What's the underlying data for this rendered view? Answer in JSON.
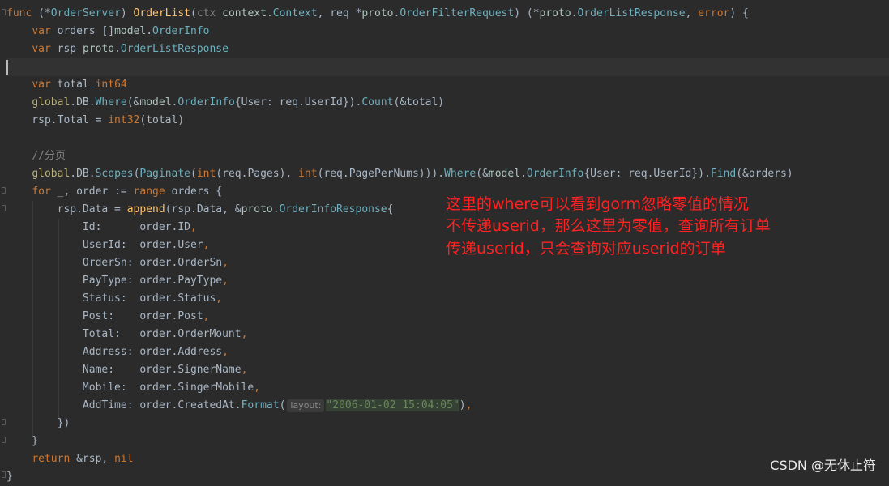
{
  "editor": {
    "lines": [
      [
        {
          "t": "func",
          "c": "kw"
        },
        {
          "t": " (*"
        },
        {
          "t": "OrderServer",
          "c": "ty"
        },
        {
          "t": ") "
        },
        {
          "t": "OrderList",
          "c": "fn"
        },
        {
          "t": "("
        },
        {
          "t": "ctx",
          "c": "cm"
        },
        {
          "t": " "
        },
        {
          "t": "context",
          "c": "pk"
        },
        {
          "t": "."
        },
        {
          "t": "Context",
          "c": "ty"
        },
        {
          "t": ", "
        },
        {
          "t": "req",
          "c": "pa"
        },
        {
          "t": " *"
        },
        {
          "t": "proto",
          "c": "pk"
        },
        {
          "t": "."
        },
        {
          "t": "OrderFilterRequest",
          "c": "ty"
        },
        {
          "t": ") (*"
        },
        {
          "t": "proto",
          "c": "pk"
        },
        {
          "t": "."
        },
        {
          "t": "OrderListResponse",
          "c": "ty"
        },
        {
          "t": ", "
        },
        {
          "t": "error",
          "c": "kw"
        },
        {
          "t": ") {"
        }
      ],
      [
        {
          "t": "    "
        },
        {
          "t": "var",
          "c": "kw"
        },
        {
          "t": " orders []"
        },
        {
          "t": "model",
          "c": "pk"
        },
        {
          "t": "."
        },
        {
          "t": "OrderInfo",
          "c": "ty"
        }
      ],
      [
        {
          "t": "    "
        },
        {
          "t": "var",
          "c": "kw"
        },
        {
          "t": " rsp "
        },
        {
          "t": "proto",
          "c": "pk"
        },
        {
          "t": "."
        },
        {
          "t": "OrderListResponse",
          "c": "ty"
        }
      ],
      [
        {
          "t": ""
        }
      ],
      [
        {
          "t": "    "
        },
        {
          "t": "var",
          "c": "kw"
        },
        {
          "t": " total "
        },
        {
          "t": "int64",
          "c": "kw"
        }
      ],
      [
        {
          "t": "    "
        },
        {
          "t": "global",
          "c": "gl"
        },
        {
          "t": "."
        },
        {
          "t": "DB",
          "c": "pa"
        },
        {
          "t": "."
        },
        {
          "t": "Where",
          "c": "ty"
        },
        {
          "t": "(&"
        },
        {
          "t": "model",
          "c": "pk"
        },
        {
          "t": "."
        },
        {
          "t": "OrderInfo",
          "c": "ty"
        },
        {
          "t": "{User: req.UserId})."
        },
        {
          "t": "Count",
          "c": "ty"
        },
        {
          "t": "(&total)"
        }
      ],
      [
        {
          "t": "    rsp.Total = "
        },
        {
          "t": "int32",
          "c": "kw"
        },
        {
          "t": "(total)"
        }
      ],
      [
        {
          "t": ""
        }
      ],
      [
        {
          "t": "    "
        },
        {
          "t": "//分页",
          "c": "cm"
        }
      ],
      [
        {
          "t": "    "
        },
        {
          "t": "global",
          "c": "gl"
        },
        {
          "t": "."
        },
        {
          "t": "DB",
          "c": "pa"
        },
        {
          "t": "."
        },
        {
          "t": "Scopes",
          "c": "ty"
        },
        {
          "t": "("
        },
        {
          "t": "Paginate",
          "c": "ty"
        },
        {
          "t": "("
        },
        {
          "t": "int",
          "c": "kw"
        },
        {
          "t": "(req.Pages), "
        },
        {
          "t": "int",
          "c": "kw"
        },
        {
          "t": "(req.PagePerNums)))."
        },
        {
          "t": "Where",
          "c": "ty"
        },
        {
          "t": "(&"
        },
        {
          "t": "model",
          "c": "pk"
        },
        {
          "t": "."
        },
        {
          "t": "OrderInfo",
          "c": "ty"
        },
        {
          "t": "{User: req.UserId})."
        },
        {
          "t": "Find",
          "c": "ty"
        },
        {
          "t": "(&orders)"
        }
      ],
      [
        {
          "t": "    "
        },
        {
          "t": "for",
          "c": "kw"
        },
        {
          "t": " _, order := "
        },
        {
          "t": "range",
          "c": "kw"
        },
        {
          "t": " orders {"
        }
      ],
      [
        {
          "t": "        rsp.Data = "
        },
        {
          "t": "append",
          "c": "fn"
        },
        {
          "t": "(rsp.Data, &"
        },
        {
          "t": "proto",
          "c": "pk"
        },
        {
          "t": "."
        },
        {
          "t": "OrderInfoResponse",
          "c": "ty"
        },
        {
          "t": "{"
        }
      ],
      [
        {
          "t": "            Id:      order.ID"
        },
        {
          "t": ",",
          "c": "kw"
        }
      ],
      [
        {
          "t": "            UserId:  order.User"
        },
        {
          "t": ",",
          "c": "kw"
        }
      ],
      [
        {
          "t": "            OrderSn: order.OrderSn"
        },
        {
          "t": ",",
          "c": "kw"
        }
      ],
      [
        {
          "t": "            PayType: order.PayType"
        },
        {
          "t": ",",
          "c": "kw"
        }
      ],
      [
        {
          "t": "            Status:  order.Status"
        },
        {
          "t": ",",
          "c": "kw"
        }
      ],
      [
        {
          "t": "            Post:    order.Post"
        },
        {
          "t": ",",
          "c": "kw"
        }
      ],
      [
        {
          "t": "            Total:   order.OrderMount"
        },
        {
          "t": ",",
          "c": "kw"
        }
      ],
      [
        {
          "t": "            Address: order.Address"
        },
        {
          "t": ",",
          "c": "kw"
        }
      ],
      [
        {
          "t": "            Name:    order.SignerName"
        },
        {
          "t": ",",
          "c": "kw"
        }
      ],
      [
        {
          "t": "            Mobile:  order.SingerMobile"
        },
        {
          "t": ",",
          "c": "kw"
        }
      ],
      [
        {
          "t": "            AddTime: order.CreatedAt."
        },
        {
          "t": "Format",
          "c": "ty"
        },
        {
          "t": "("
        },
        {
          "t": "layout:",
          "c": "hint"
        },
        {
          "t": "\"2006-01-02 15:04:05\"",
          "c": "st"
        },
        {
          "t": ")"
        },
        {
          "t": ",",
          "c": "kw"
        }
      ],
      [
        {
          "t": "        })"
        }
      ],
      [
        {
          "t": "    }"
        }
      ],
      [
        {
          "t": "    "
        },
        {
          "t": "return",
          "c": "kw"
        },
        {
          "t": " &rsp, "
        },
        {
          "t": "nil",
          "c": "kw"
        }
      ],
      [
        {
          "t": "}"
        }
      ]
    ]
  },
  "annotation": {
    "lines": [
      "这里的where可以看到gorm忽略零值的情况",
      "不传递userid，那么这里为零值，查询所有订单",
      "传递userid，只会查询对应userid的订单"
    ]
  },
  "watermark": "CSDN @无休止符"
}
